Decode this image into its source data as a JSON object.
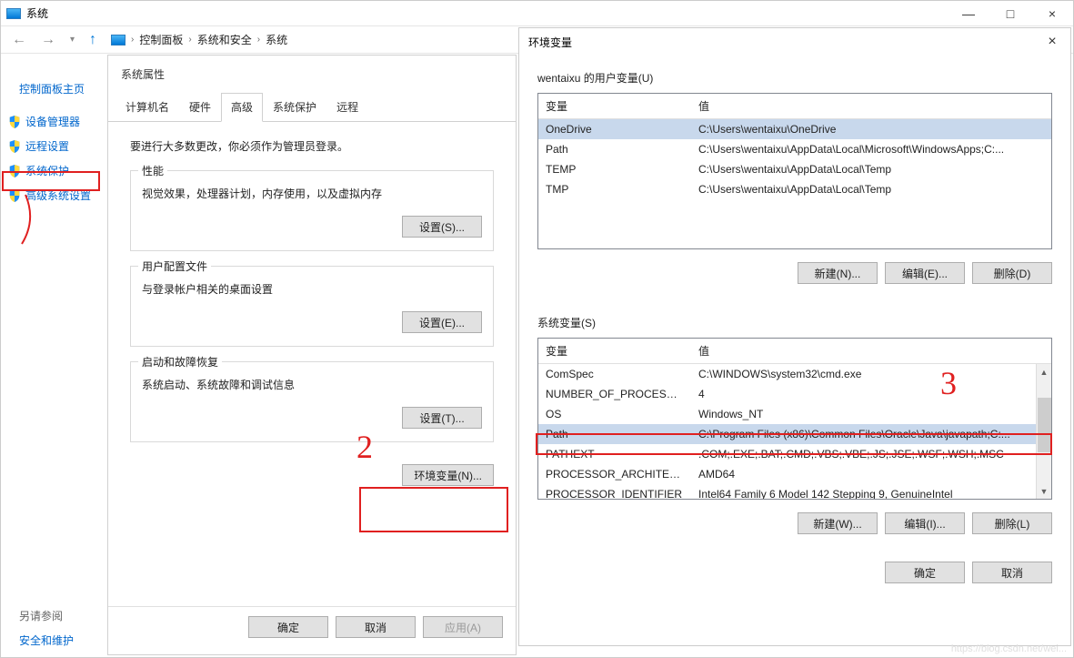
{
  "window": {
    "title": "系统",
    "minimize": "—",
    "maximize": "□",
    "close": "×"
  },
  "breadcrumb": {
    "items": [
      "控制面板",
      "系统和安全",
      "系统"
    ]
  },
  "sidebar": {
    "title": "控制面板主页",
    "items": [
      {
        "label": "设备管理器"
      },
      {
        "label": "远程设置"
      },
      {
        "label": "系统保护"
      },
      {
        "label": "高级系统设置"
      }
    ],
    "footer_title": "另请参阅",
    "footer_link": "安全和维护"
  },
  "sysprops": {
    "title": "系统属性",
    "tabs": [
      "计算机名",
      "硬件",
      "高级",
      "系统保护",
      "远程"
    ],
    "active_tab": 2,
    "admin_note": "要进行大多数更改，你必须作为管理员登录。",
    "groups": [
      {
        "title": "性能",
        "desc": "视觉效果，处理器计划，内存使用，以及虚拟内存",
        "btn": "设置(S)..."
      },
      {
        "title": "用户配置文件",
        "desc": "与登录帐户相关的桌面设置",
        "btn": "设置(E)..."
      },
      {
        "title": "启动和故障恢复",
        "desc": "系统启动、系统故障和调试信息",
        "btn": "设置(T)..."
      }
    ],
    "envvar_btn": "环境变量(N)...",
    "ok": "确定",
    "cancel": "取消",
    "apply": "应用(A)"
  },
  "envdialog": {
    "title": "环境变量",
    "user_section_title": "wentaixu 的用户变量(U)",
    "col_var": "变量",
    "col_val": "值",
    "user_vars": [
      {
        "name": "OneDrive",
        "value": "C:\\Users\\wentaixu\\OneDrive",
        "selected": true
      },
      {
        "name": "Path",
        "value": "C:\\Users\\wentaixu\\AppData\\Local\\Microsoft\\WindowsApps;C:..."
      },
      {
        "name": "TEMP",
        "value": "C:\\Users\\wentaixu\\AppData\\Local\\Temp"
      },
      {
        "name": "TMP",
        "value": "C:\\Users\\wentaixu\\AppData\\Local\\Temp"
      }
    ],
    "new_u": "新建(N)...",
    "edit_u": "编辑(E)...",
    "del_u": "删除(D)",
    "sys_section_title": "系统变量(S)",
    "sys_vars": [
      {
        "name": "ComSpec",
        "value": "C:\\WINDOWS\\system32\\cmd.exe"
      },
      {
        "name": "NUMBER_OF_PROCESSORS",
        "value": "4"
      },
      {
        "name": "OS",
        "value": "Windows_NT"
      },
      {
        "name": "Path",
        "value": "C:\\Program Files (x86)\\Common Files\\Oracle\\Java\\javapath;C:...",
        "selected": true
      },
      {
        "name": "PATHEXT",
        "value": ".COM;.EXE;.BAT;.CMD;.VBS;.VBE;.JS;.JSE;.WSF;.WSH;.MSC"
      },
      {
        "name": "PROCESSOR_ARCHITECT...",
        "value": "AMD64"
      },
      {
        "name": "PROCESSOR_IDENTIFIER",
        "value": "Intel64 Family 6 Model 142 Stepping 9, GenuineIntel"
      }
    ],
    "new_s": "新建(W)...",
    "edit_s": "编辑(I)...",
    "del_s": "删除(L)",
    "ok": "确定",
    "cancel": "取消"
  },
  "annotations": {
    "num2": "2",
    "num3": "3"
  },
  "watermark": "https://blog.csdn.net/wei..."
}
